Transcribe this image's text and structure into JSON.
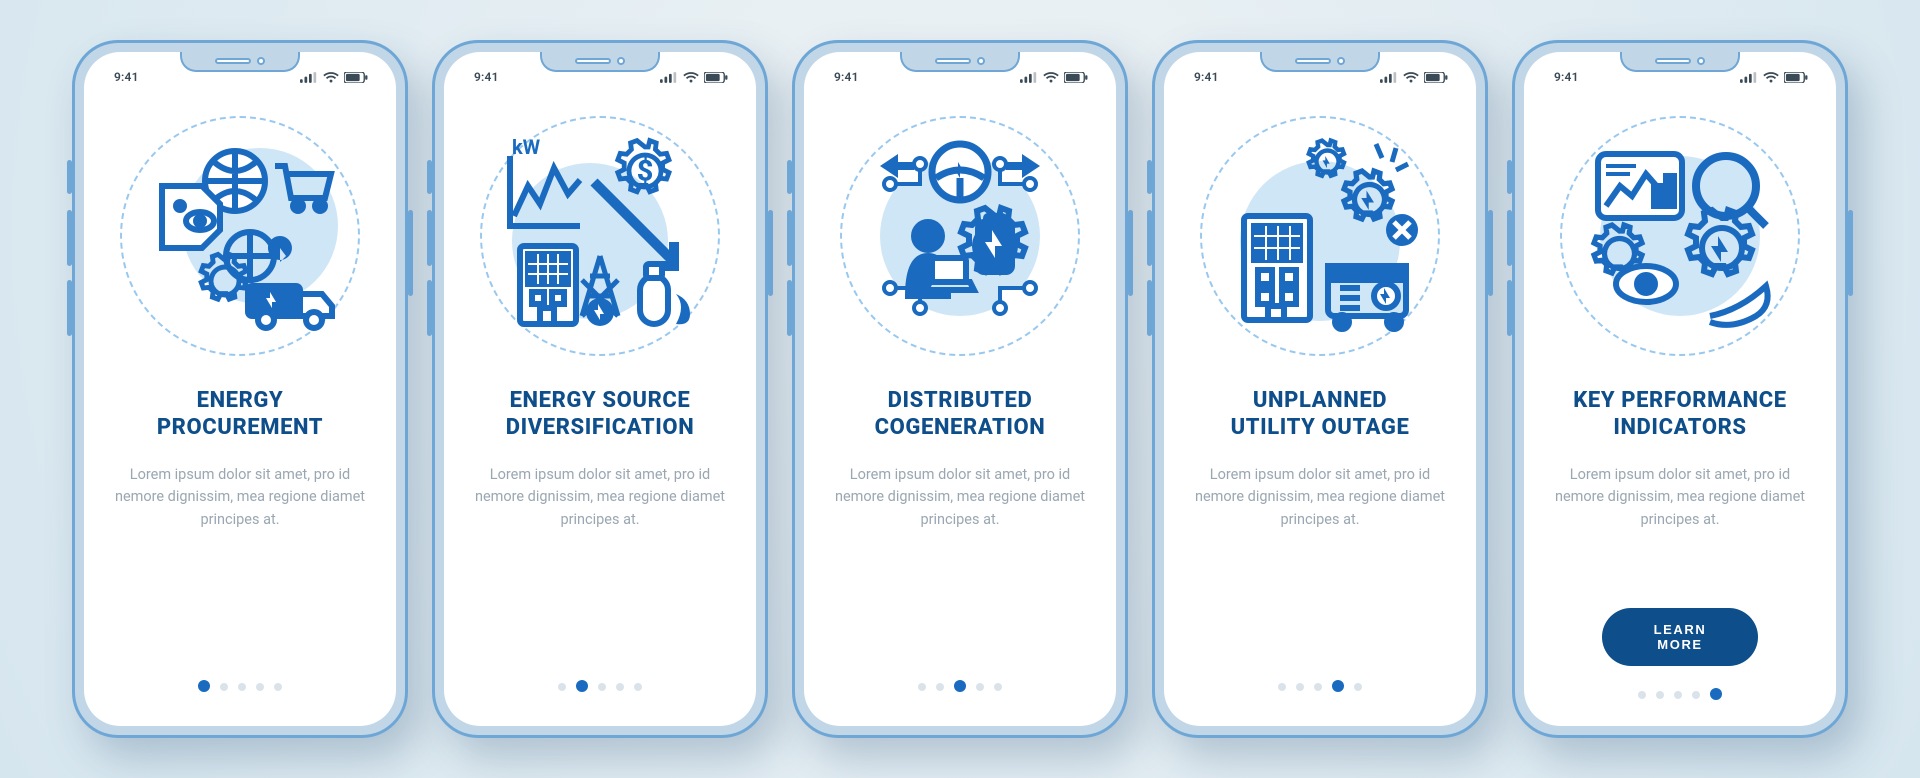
{
  "statusbar": {
    "time": "9:41"
  },
  "screens": [
    {
      "title": "ENERGY\nPROCUREMENT",
      "body": "Lorem ipsum dolor sit amet, pro id nemore dignissim, mea regione diamet principes at.",
      "icon": "procurement"
    },
    {
      "title": "ENERGY SOURCE\nDIVERSIFICATION",
      "body": "Lorem ipsum dolor sit amet, pro id nemore dignissim, mea regione diamet principes at.",
      "icon": "diversification"
    },
    {
      "title": "DISTRIBUTED\nCOGENERATION",
      "body": "Lorem ipsum dolor sit amet, pro id nemore dignissim, mea regione diamet principes at.",
      "icon": "cogeneration"
    },
    {
      "title": "UNPLANNED\nUTILITY OUTAGE",
      "body": "Lorem ipsum dolor sit amet, pro id nemore dignissim, mea regione diamet principes at.",
      "icon": "outage"
    },
    {
      "title": "KEY PERFORMANCE\nINDICATORS",
      "body": "Lorem ipsum dolor sit amet, pro id nemore dignissim, mea regione diamet principes at.",
      "icon": "kpi",
      "cta": "LEARN MORE"
    }
  ],
  "colors": {
    "accent": "#0e4e8a",
    "accent_light": "#2f8fe0",
    "dot_inactive": "#dbe3ea"
  }
}
